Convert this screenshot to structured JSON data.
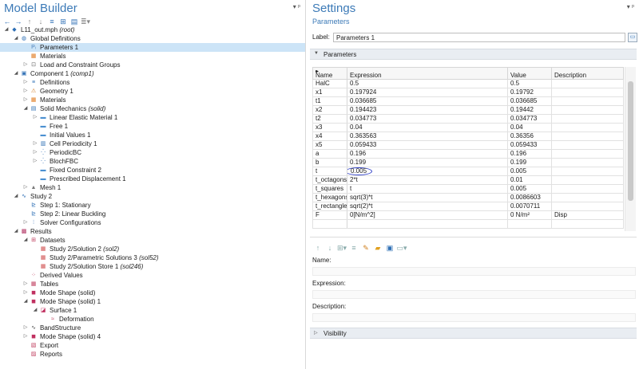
{
  "model_builder": {
    "title": "Model Builder",
    "controls": "▾ ᵖ",
    "toolbar_icons": [
      "back-arrow-icon",
      "forward-arrow-icon",
      "up-arrow-icon",
      "down-arrow-icon",
      "collapse-all-icon",
      "expand-all-icon",
      "show-more-icon",
      "menu-icon"
    ],
    "tree": [
      {
        "label": "L11_out.mph",
        "suffix": "(root)",
        "depth": 0,
        "arrow": "◢",
        "icon": "root-icon",
        "selected": false
      },
      {
        "label": "Global Definitions",
        "suffix": "",
        "depth": 1,
        "arrow": "◢",
        "icon": "globe-icon",
        "selected": false
      },
      {
        "label": "Parameters 1",
        "suffix": "",
        "depth": 2,
        "arrow": "",
        "icon": "parameters-icon",
        "selected": true
      },
      {
        "label": "Materials",
        "suffix": "",
        "depth": 2,
        "arrow": "",
        "icon": "materials-icon",
        "selected": false
      },
      {
        "label": "Load and Constraint Groups",
        "suffix": "",
        "depth": 2,
        "arrow": "▷",
        "icon": "groups-icon",
        "selected": false
      },
      {
        "label": "Component 1",
        "suffix": "(comp1)",
        "depth": 1,
        "arrow": "◢",
        "icon": "component-icon",
        "selected": false
      },
      {
        "label": "Definitions",
        "suffix": "",
        "depth": 2,
        "arrow": "▷",
        "icon": "definitions-icon",
        "selected": false
      },
      {
        "label": "Geometry 1",
        "suffix": "",
        "depth": 2,
        "arrow": "▷",
        "icon": "geometry-icon",
        "selected": false
      },
      {
        "label": "Materials",
        "suffix": "",
        "depth": 2,
        "arrow": "▷",
        "icon": "materials-icon",
        "selected": false
      },
      {
        "label": "Solid Mechanics",
        "suffix": "(solid)",
        "depth": 2,
        "arrow": "◢",
        "icon": "solid-mechanics-icon",
        "selected": false
      },
      {
        "label": "Linear Elastic Material 1",
        "suffix": "",
        "depth": 3,
        "arrow": "▷",
        "icon": "feature-icon",
        "selected": false
      },
      {
        "label": "Free 1",
        "suffix": "",
        "depth": 3,
        "arrow": "",
        "icon": "feature-icon",
        "selected": false
      },
      {
        "label": "Initial Values 1",
        "suffix": "",
        "depth": 3,
        "arrow": "",
        "icon": "feature-icon",
        "selected": false
      },
      {
        "label": "Cell Periodicity 1",
        "suffix": "",
        "depth": 3,
        "arrow": "▷",
        "icon": "periodicity-icon",
        "selected": false
      },
      {
        "label": "PeriodicBC",
        "suffix": "",
        "depth": 3,
        "arrow": "▷",
        "icon": "periodic-bc-icon",
        "selected": false
      },
      {
        "label": "BlochFBC",
        "suffix": "",
        "depth": 3,
        "arrow": "▷",
        "icon": "periodic-bc-icon",
        "selected": false
      },
      {
        "label": "Fixed Constraint 2",
        "suffix": "",
        "depth": 3,
        "arrow": "",
        "icon": "feature-icon",
        "selected": false
      },
      {
        "label": "Prescribed Displacement 1",
        "suffix": "",
        "depth": 3,
        "arrow": "",
        "icon": "feature-icon",
        "selected": false
      },
      {
        "label": "Mesh 1",
        "suffix": "",
        "depth": 2,
        "arrow": "▷",
        "icon": "mesh-icon",
        "selected": false
      },
      {
        "label": "Study 2",
        "suffix": "",
        "depth": 1,
        "arrow": "◢",
        "icon": "study-icon",
        "selected": false
      },
      {
        "label": "Step 1: Stationary",
        "suffix": "",
        "depth": 2,
        "arrow": "",
        "icon": "step-icon",
        "selected": false
      },
      {
        "label": "Step 2: Linear Buckling",
        "suffix": "",
        "depth": 2,
        "arrow": "",
        "icon": "step-icon",
        "selected": false
      },
      {
        "label": "Solver Configurations",
        "suffix": "",
        "depth": 2,
        "arrow": "▷",
        "icon": "solver-icon",
        "selected": false
      },
      {
        "label": "Results",
        "suffix": "",
        "depth": 1,
        "arrow": "◢",
        "icon": "results-icon",
        "selected": false
      },
      {
        "label": "Datasets",
        "suffix": "",
        "depth": 2,
        "arrow": "◢",
        "icon": "datasets-icon",
        "selected": false
      },
      {
        "label": "Study 2/Solution 2",
        "suffix": "(sol2)",
        "depth": 3,
        "arrow": "",
        "icon": "dataset-icon",
        "selected": false
      },
      {
        "label": "Study 2/Parametric Solutions 3",
        "suffix": "(sol52)",
        "depth": 3,
        "arrow": "",
        "icon": "dataset-icon",
        "selected": false
      },
      {
        "label": "Study 2/Solution Store 1",
        "suffix": "(sol246)",
        "depth": 3,
        "arrow": "",
        "icon": "dataset-icon",
        "selected": false
      },
      {
        "label": "Derived Values",
        "suffix": "",
        "depth": 2,
        "arrow": "",
        "icon": "derived-values-icon",
        "selected": false
      },
      {
        "label": "Tables",
        "suffix": "",
        "depth": 2,
        "arrow": "▷",
        "icon": "tables-icon",
        "selected": false
      },
      {
        "label": "Mode Shape (solid)",
        "suffix": "",
        "depth": 2,
        "arrow": "▷",
        "icon": "plot-group-icon",
        "selected": false
      },
      {
        "label": "Mode Shape (solid) 1",
        "suffix": "",
        "depth": 2,
        "arrow": "◢",
        "icon": "plot-group-icon",
        "selected": false
      },
      {
        "label": "Surface 1",
        "suffix": "",
        "depth": 3,
        "arrow": "◢",
        "icon": "surface-icon",
        "selected": false
      },
      {
        "label": "Deformation",
        "suffix": "",
        "depth": 4,
        "arrow": "",
        "icon": "deformation-icon",
        "selected": false
      },
      {
        "label": "BandStructure",
        "suffix": "",
        "depth": 2,
        "arrow": "▷",
        "icon": "band-structure-icon",
        "selected": false
      },
      {
        "label": "Mode Shape (solid) 4",
        "suffix": "",
        "depth": 2,
        "arrow": "▷",
        "icon": "plot-group-icon",
        "selected": false
      },
      {
        "label": "Export",
        "suffix": "",
        "depth": 2,
        "arrow": "",
        "icon": "export-icon",
        "selected": false
      },
      {
        "label": "Reports",
        "suffix": "",
        "depth": 2,
        "arrow": "",
        "icon": "reports-icon",
        "selected": false
      }
    ]
  },
  "settings": {
    "title": "Settings",
    "subtitle": "Parameters",
    "controls": "▾ ᵖ",
    "label_caption": "Label:",
    "label_value": "Parameters 1",
    "section_parameters": "Parameters",
    "columns": {
      "name": "Name",
      "expression": "Expression",
      "value": "Value",
      "description": "Description"
    },
    "rows": [
      {
        "name": "HalC",
        "expression": "0.5",
        "value": "0.5",
        "description": ""
      },
      {
        "name": "x1",
        "expression": "0.197924",
        "value": "0.19792",
        "description": ""
      },
      {
        "name": "t1",
        "expression": "0.036685",
        "value": "0.036685",
        "description": ""
      },
      {
        "name": "x2",
        "expression": "0.194423",
        "value": "0.19442",
        "description": ""
      },
      {
        "name": "t2",
        "expression": "0.034773",
        "value": "0.034773",
        "description": ""
      },
      {
        "name": "x3",
        "expression": "0.04",
        "value": "0.04",
        "description": ""
      },
      {
        "name": "x4",
        "expression": "0.363563",
        "value": "0.36356",
        "description": ""
      },
      {
        "name": "x5",
        "expression": "0.059433",
        "value": "0.059433",
        "description": ""
      },
      {
        "name": "a",
        "expression": "0.196",
        "value": "0.196",
        "description": ""
      },
      {
        "name": "b",
        "expression": "0.199",
        "value": "0.199",
        "description": ""
      },
      {
        "name": "t",
        "expression": "0.005",
        "value": "0.005",
        "description": ""
      },
      {
        "name": "t_octagons",
        "expression": "2*t",
        "value": "0.01",
        "description": ""
      },
      {
        "name": "t_squares",
        "expression": "t",
        "value": "0.005",
        "description": ""
      },
      {
        "name": "t_hexagons",
        "expression": "sqrt(3)*t",
        "value": "0.0086603",
        "description": ""
      },
      {
        "name": "t_rectangles",
        "expression": "sqrt(2)*t",
        "value": "0.0070711",
        "description": ""
      },
      {
        "name": "F",
        "expression": "0[N/m^2]",
        "value": "0 N/m²",
        "description": "Disp"
      },
      {
        "name": "",
        "expression": "",
        "value": "",
        "description": ""
      }
    ],
    "table_toolbar_icons": [
      "move-up-icon",
      "move-down-icon",
      "add-icon",
      "delete-icon",
      "clear-icon",
      "load-icon",
      "save-icon",
      "more-icon"
    ],
    "field_name_label": "Name:",
    "field_expression_label": "Expression:",
    "field_description_label": "Description:",
    "section_visibility": "Visibility"
  }
}
